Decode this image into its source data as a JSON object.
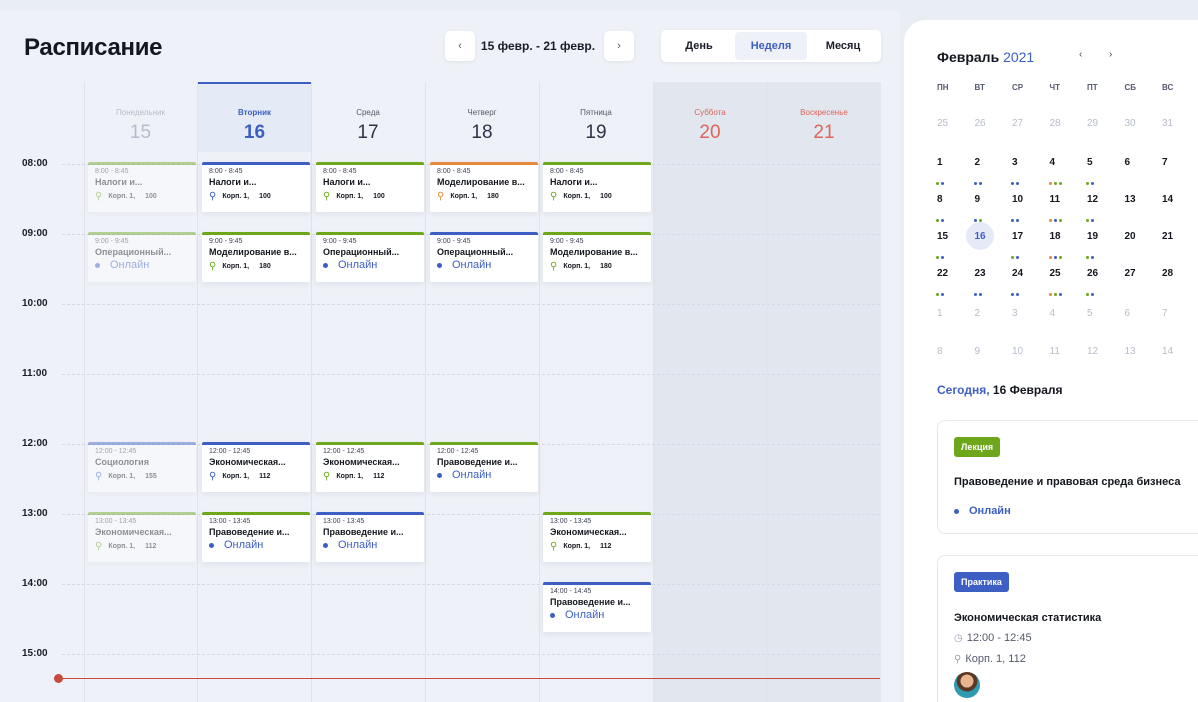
{
  "title": "Расписание",
  "nav": {
    "prev": "‹",
    "next": "›",
    "range": "15 февр. - 21 февр."
  },
  "view_switch": [
    "День",
    "Неделя",
    "Месяц"
  ],
  "days": [
    {
      "name": "Понедельник",
      "date": "15"
    },
    {
      "name": "Вторник",
      "date": "16"
    },
    {
      "name": "Среда",
      "date": "17"
    },
    {
      "name": "Четверг",
      "date": "18"
    },
    {
      "name": "Пятница",
      "date": "19"
    },
    {
      "name": "Суббота",
      "date": "20"
    },
    {
      "name": "Воскресенье",
      "date": "21"
    }
  ],
  "times": [
    "08:00",
    "09:00",
    "10:00",
    "11:00",
    "12:00",
    "13:00",
    "14:00",
    "15:00"
  ],
  "events": [
    {
      "time": "8:00 - 8:45",
      "name": "Налоги и...",
      "building": "Корп. 1,",
      "room": "100"
    },
    {
      "time": "9:00 - 9:45",
      "name": "Операционный...",
      "online": "Онлайн"
    },
    {
      "time": "12:00 - 12:45",
      "name": "Социология",
      "building": "Корп. 1,",
      "room": "155"
    },
    {
      "time": "13:00 - 13:45",
      "name": "Экономическая...",
      "building": "Корп. 1,",
      "room": "112"
    },
    {
      "time": "8:00 - 8:45",
      "name": "Налоги и...",
      "building": "Корп. 1,",
      "room": "100"
    },
    {
      "time": "9:00 - 9:45",
      "name": "Моделирование в...",
      "building": "Корп. 1,",
      "room": "180"
    },
    {
      "time": "12:00 - 12:45",
      "name": "Экономическая...",
      "building": "Корп. 1,",
      "room": "112"
    },
    {
      "time": "13:00 - 13:45",
      "name": "Правоведение и...",
      "online": "Онлайн"
    },
    {
      "time": "8:00 - 8:45",
      "name": "Налоги и...",
      "building": "Корп. 1,",
      "room": "100"
    },
    {
      "time": "9:00 - 9:45",
      "name": "Операционный...",
      "online": "Онлайн"
    },
    {
      "time": "12:00 - 12:45",
      "name": "Экономическая...",
      "building": "Корп. 1,",
      "room": "112"
    },
    {
      "time": "13:00 - 13:45",
      "name": "Правоведение и...",
      "online": "Онлайн"
    },
    {
      "time": "8:00 - 8:45",
      "name": "Моделирование в...",
      "building": "Корп. 1,",
      "room": "180"
    },
    {
      "time": "9:00 - 9:45",
      "name": "Операционный...",
      "online": "Онлайн"
    },
    {
      "time": "12:00 - 12:45",
      "name": "Правоведение и...",
      "online": "Онлайн"
    },
    {
      "time": "8:00 - 8:45",
      "name": "Налоги и...",
      "building": "Корп. 1,",
      "room": "100"
    },
    {
      "time": "9:00 - 9:45",
      "name": "Моделирование в...",
      "building": "Корп. 1,",
      "room": "180"
    },
    {
      "time": "13:00 - 13:45",
      "name": "Экономическая...",
      "building": "Корп. 1,",
      "room": "112"
    },
    {
      "time": "14:00 - 14:45",
      "name": "Правоведение и...",
      "online": "Онлайн"
    }
  ],
  "calendar": {
    "month": "Февраль",
    "year": "2021",
    "prev": "‹",
    "next": "›",
    "weekdays": [
      "ПН",
      "ВТ",
      "СР",
      "ЧТ",
      "ПТ",
      "СБ",
      "ВС"
    ],
    "rows": [
      [
        "25",
        "26",
        "27",
        "28",
        "29",
        "30",
        "31"
      ],
      [
        "1",
        "2",
        "3",
        "4",
        "5",
        "6",
        "7"
      ],
      [
        "8",
        "9",
        "10",
        "11",
        "12",
        "13",
        "14"
      ],
      [
        "15",
        "16",
        "17",
        "18",
        "19",
        "20",
        "21"
      ],
      [
        "22",
        "23",
        "24",
        "25",
        "26",
        "27",
        "28"
      ],
      [
        "1",
        "2",
        "3",
        "4",
        "5",
        "6",
        "7"
      ],
      [
        "8",
        "9",
        "10",
        "11",
        "12",
        "13",
        "14"
      ]
    ]
  },
  "today": {
    "prefix": "Сегодня,",
    "date": "16 Февраля"
  },
  "cards": [
    {
      "badge": "Лекция",
      "name": "Правоведение и правовая среда бизнеса",
      "online": "Онлайн"
    },
    {
      "badge": "Практика",
      "name": "Экономическая статистика",
      "time": "12:00 - 12:45",
      "location": "Корп. 1, 112"
    }
  ],
  "colors": {
    "accent": "#3d5fc4",
    "lecture": "#6fa71c",
    "practice": "#3d5fc4",
    "seminar": "#e58a3a",
    "weekend": "#e0645a",
    "now_line": "#c84a3a"
  },
  "icons": {
    "location": "location-pin-icon",
    "clock": "clock-icon",
    "online": "online-dot-icon"
  }
}
